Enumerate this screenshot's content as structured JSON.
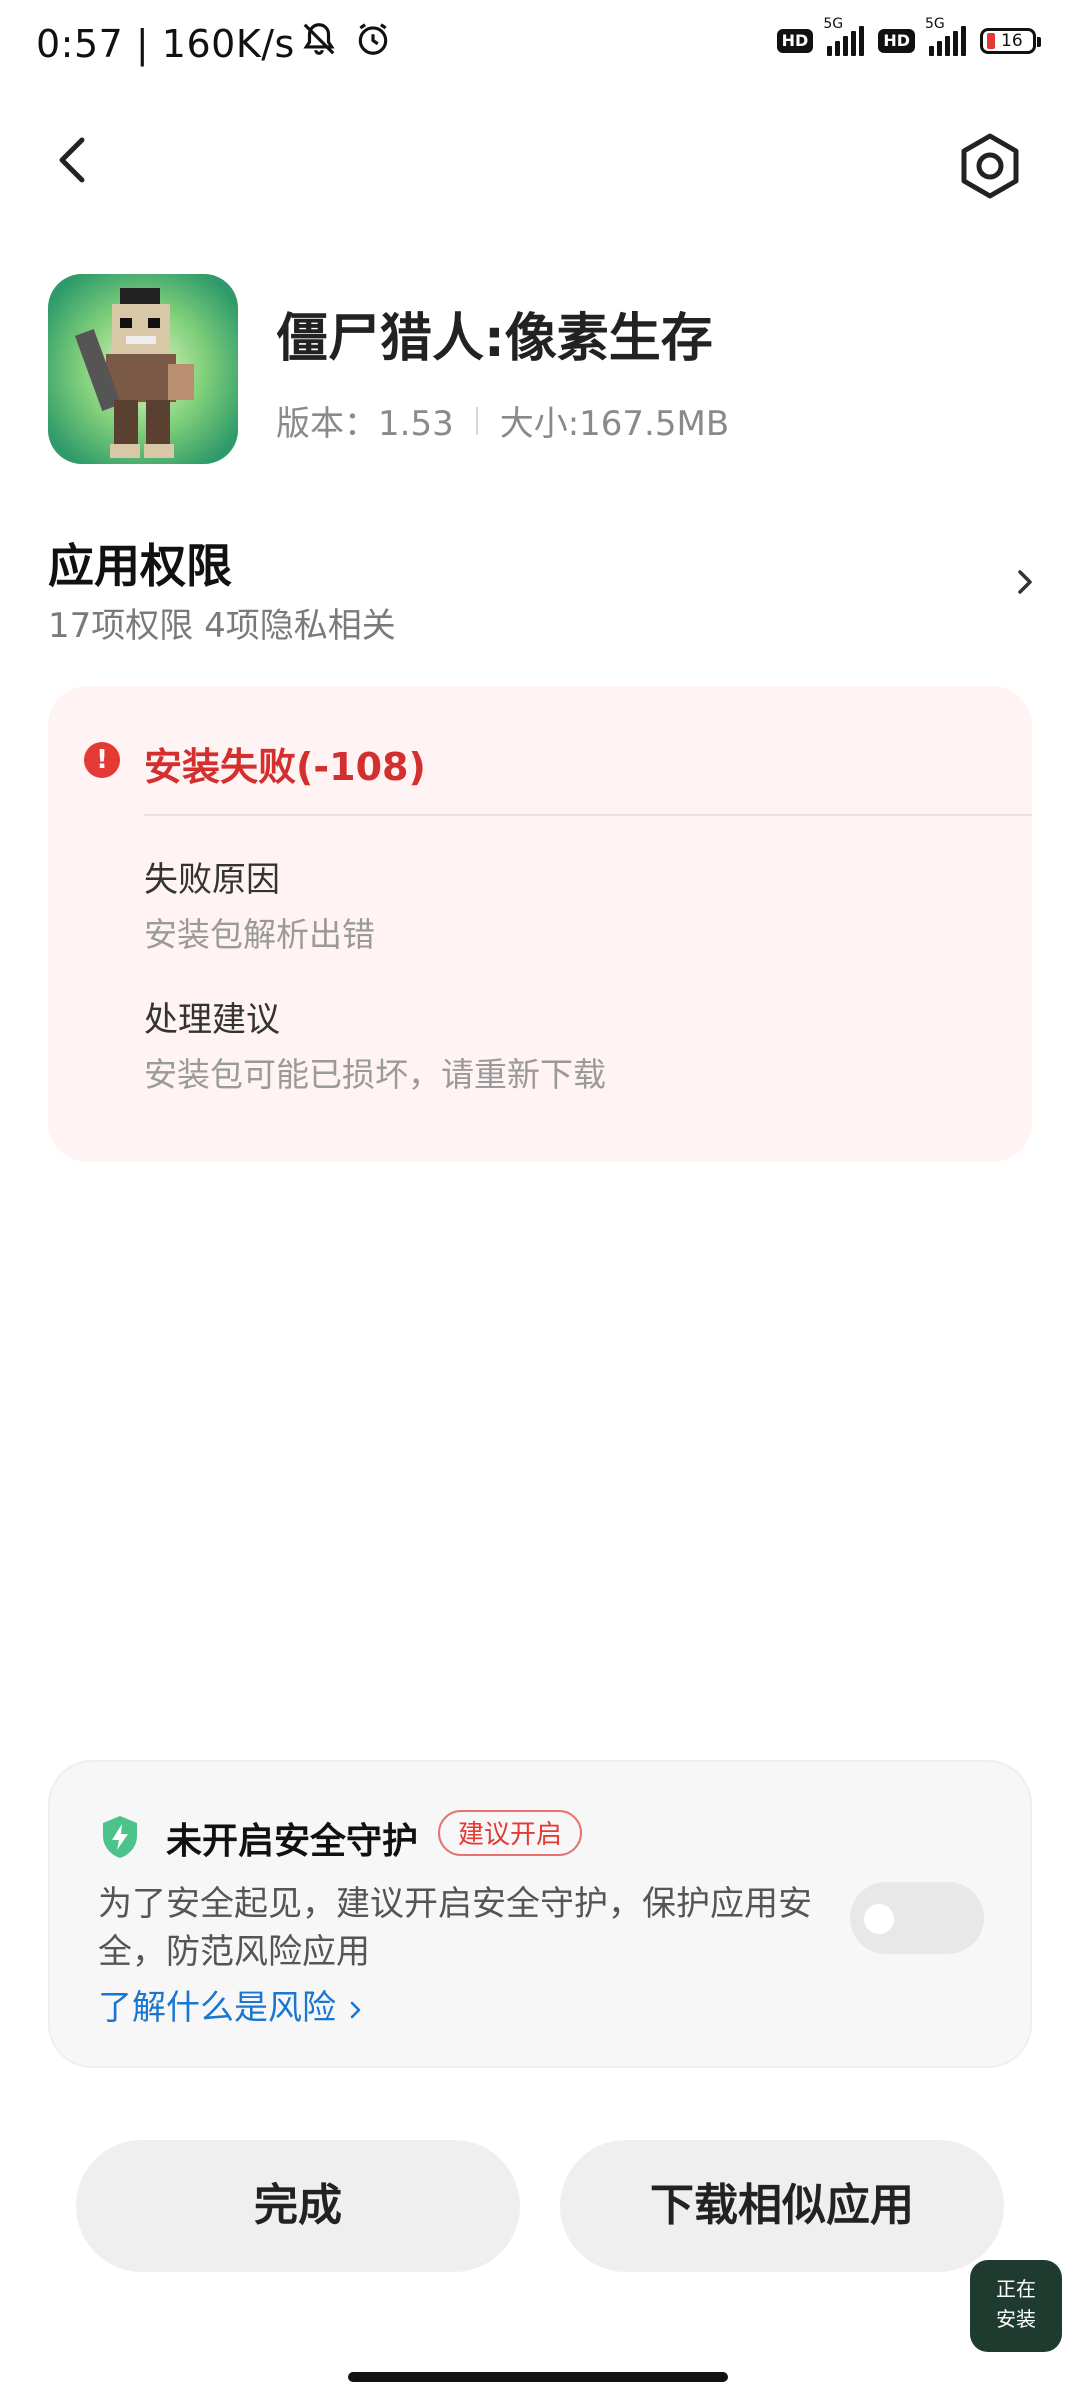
{
  "status_bar": {
    "time_speed": "0:57 | 160K/s",
    "network_1": "5G",
    "network_2": "5G",
    "hd_1": "HD",
    "hd_2": "HD",
    "battery": "16"
  },
  "header": {
    "back_icon": "back-arrow-icon",
    "settings_icon": "gear-icon"
  },
  "app": {
    "name": "僵尸猎人:像素生存",
    "version": "版本：1.53",
    "size": "大小:167.5MB"
  },
  "permissions": {
    "title": "应用权限",
    "subtitle": "17项权限 4项隐私相关"
  },
  "error": {
    "title": "安装失败(-108)",
    "reason_label": "失败原因",
    "reason_text": "安装包解析出错",
    "advice_label": "处理建议",
    "advice_text": "安装包可能已损坏，请重新下载",
    "color": "#d32f2f"
  },
  "security": {
    "title": "未开启安全守护",
    "badge": "建议开启",
    "description": "为了安全起见，建议开启安全守护，保护应用安全，防范风险应用",
    "link": "了解什么是风险",
    "toggle_on": false,
    "link_color": "#1976d2"
  },
  "buttons": {
    "done": "完成",
    "download_similar": "下载相似应用"
  },
  "install_float": {
    "line1": "正在",
    "line2": "安装"
  }
}
